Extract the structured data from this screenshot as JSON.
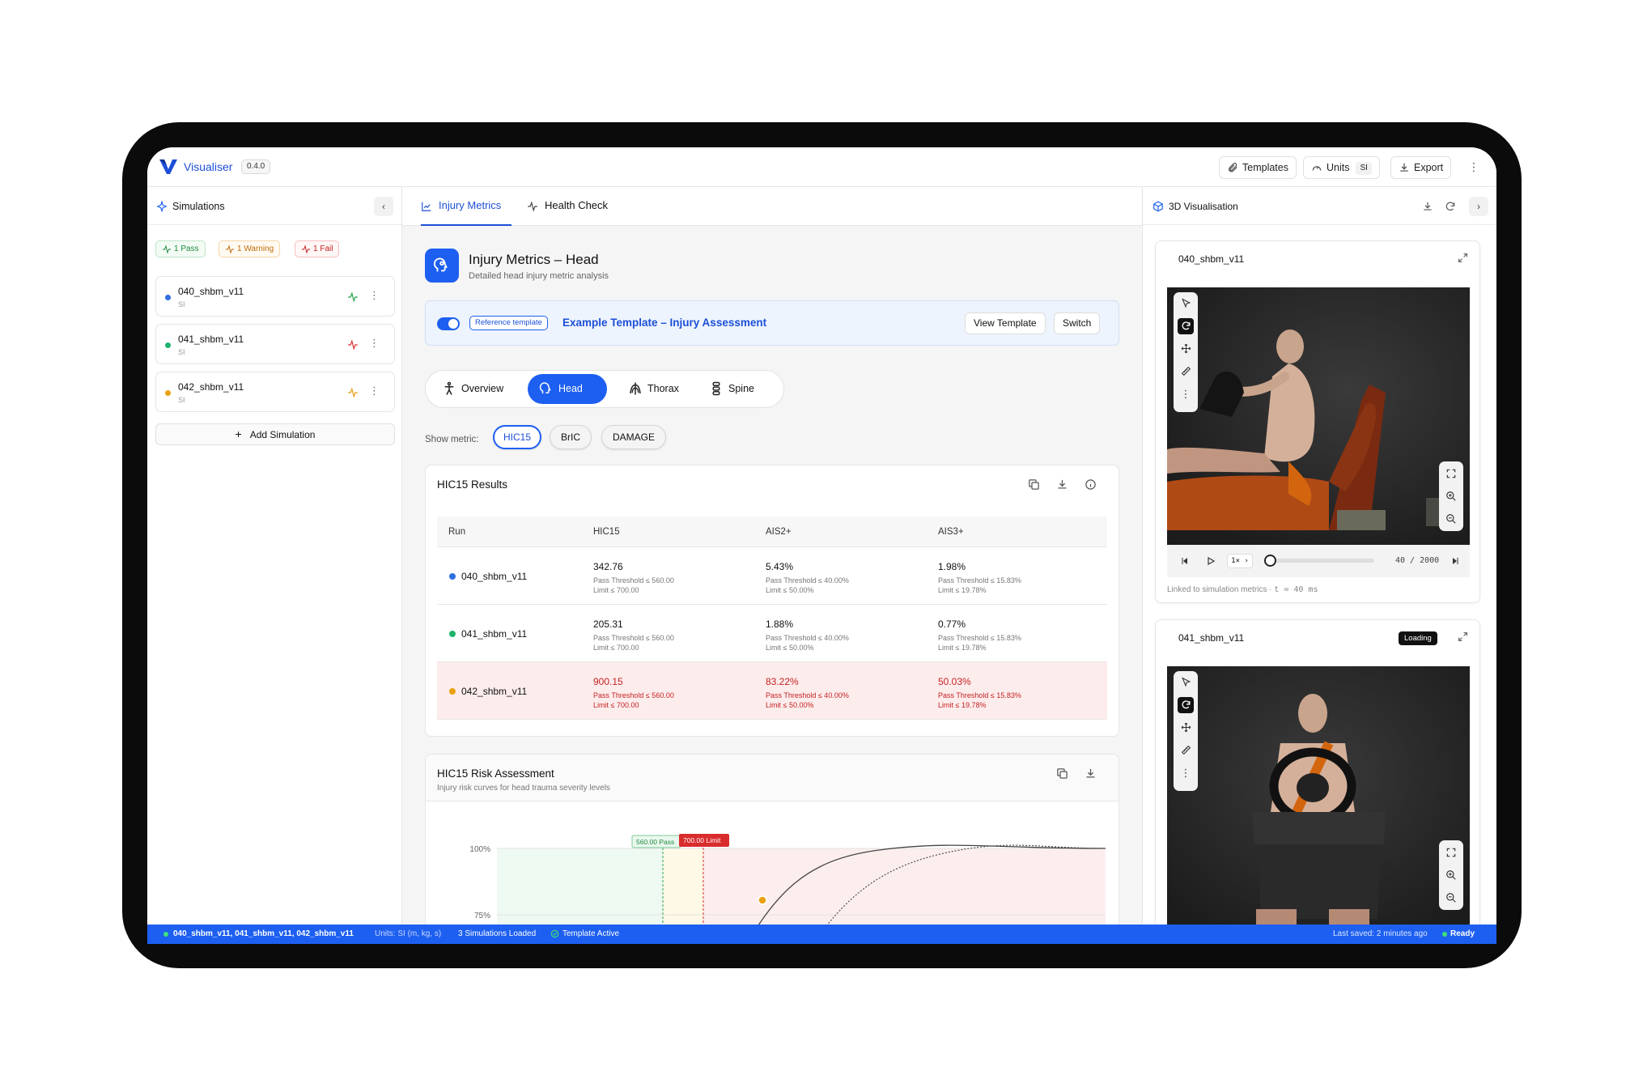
{
  "app": {
    "name": "Visualiser",
    "version": "0.4.0"
  },
  "toolbar": {
    "templates": "Templates",
    "units": "Units",
    "units_key": "SI",
    "export": "Export"
  },
  "left_panel": {
    "title": "Simulations",
    "badges": {
      "pass": "1 Pass",
      "warning": "1 Warning",
      "fail": "1 Fail"
    },
    "sims": [
      {
        "name": "040_shbm_v11",
        "sub": "SI",
        "color": "#2e6fe0",
        "status_color": "#22a04a"
      },
      {
        "name": "041_shbm_v11",
        "sub": "SI",
        "color": "#1fb36b",
        "status_color": "#d92c2c"
      },
      {
        "name": "042_shbm_v11",
        "sub": "SI",
        "color": "#eaa012",
        "status_color": "#e69a12"
      }
    ],
    "add": "Add Simulation"
  },
  "tabs": {
    "injury": "Injury Metrics",
    "health": "Health Check"
  },
  "header": {
    "title": "Injury Metrics – Head",
    "subtitle": "Detailed head injury metric analysis"
  },
  "reference": {
    "chip": "Reference template",
    "name": "Example Template – Injury Assessment",
    "view": "View Template",
    "switch": "Switch"
  },
  "body_regions": {
    "overview": "Overview",
    "head": "Head",
    "thorax": "Thorax",
    "spine": "Spine"
  },
  "metric": {
    "label": "Show metric:",
    "options": [
      "HIC15",
      "BrIC",
      "DAMAGE"
    ]
  },
  "results": {
    "title": "HIC15 Results",
    "headers": [
      "Run",
      "HIC15",
      "AIS2+",
      "AIS3+"
    ],
    "rows": [
      {
        "name": "040_shbm_v11",
        "color": "#2e6fe0",
        "hic": "342.76",
        "hic_t": "Pass Threshold ≤ 560.00",
        "hic_l": "Limit ≤ 700.00",
        "ais2": "5.43%",
        "ais2_t": "Pass Threshold ≤ 40.00%",
        "ais2_l": "Limit ≤ 50.00%",
        "ais3": "1.98%",
        "ais3_t": "Pass Threshold ≤ 15.83%",
        "ais3_l": "Limit ≤ 19.78%"
      },
      {
        "name": "041_shbm_v11",
        "color": "#1fb36b",
        "hic": "205.31",
        "hic_t": "Pass Threshold ≤ 560.00",
        "hic_l": "Limit ≤ 700.00",
        "ais2": "1.88%",
        "ais2_t": "Pass Threshold ≤ 40.00%",
        "ais2_l": "Limit ≤ 50.00%",
        "ais3": "0.77%",
        "ais3_t": "Pass Threshold ≤ 15.83%",
        "ais3_l": "Limit ≤ 19.78%"
      },
      {
        "name": "042_shbm_v11",
        "color": "#eaa012",
        "hic": "900.15",
        "hic_t": "Pass Threshold ≤ 560.00",
        "hic_l": "Limit ≤ 700.00",
        "ais2": "83.22%",
        "ais2_t": "Pass Threshold ≤ 40.00%",
        "ais2_l": "Limit ≤ 50.00%",
        "ais3": "50.03%",
        "ais3_t": "Pass Threshold ≤ 15.83%",
        "ais3_l": "Limit ≤ 19.78%"
      }
    ]
  },
  "risk": {
    "title": "HIC15 Risk Assessment",
    "subtitle": "Injury risk curves for head trauma severity levels",
    "tick_100": "100%",
    "tick_75": "75%",
    "pass_label": "560.00 Pass",
    "limit_label": "700.00 Limit"
  },
  "viz": {
    "title": "3D Visualisation",
    "card1": {
      "name": "040_shbm_v11",
      "frame": "40 / 2000",
      "speed": "1×",
      "caption": "Linked to simulation metrics",
      "time": "t = 40 ms"
    },
    "card2": {
      "name": "041_shbm_v11",
      "badge": "Loading"
    }
  },
  "status": {
    "sims": "040_shbm_v11, 041_shbm_v11, 042_shbm_v11",
    "units": "Units: SI (m, kg, s)",
    "loaded": "3 Simulations Loaded",
    "template": "Template Active",
    "saved": "Last saved: 2 minutes ago",
    "ready": "Ready"
  }
}
